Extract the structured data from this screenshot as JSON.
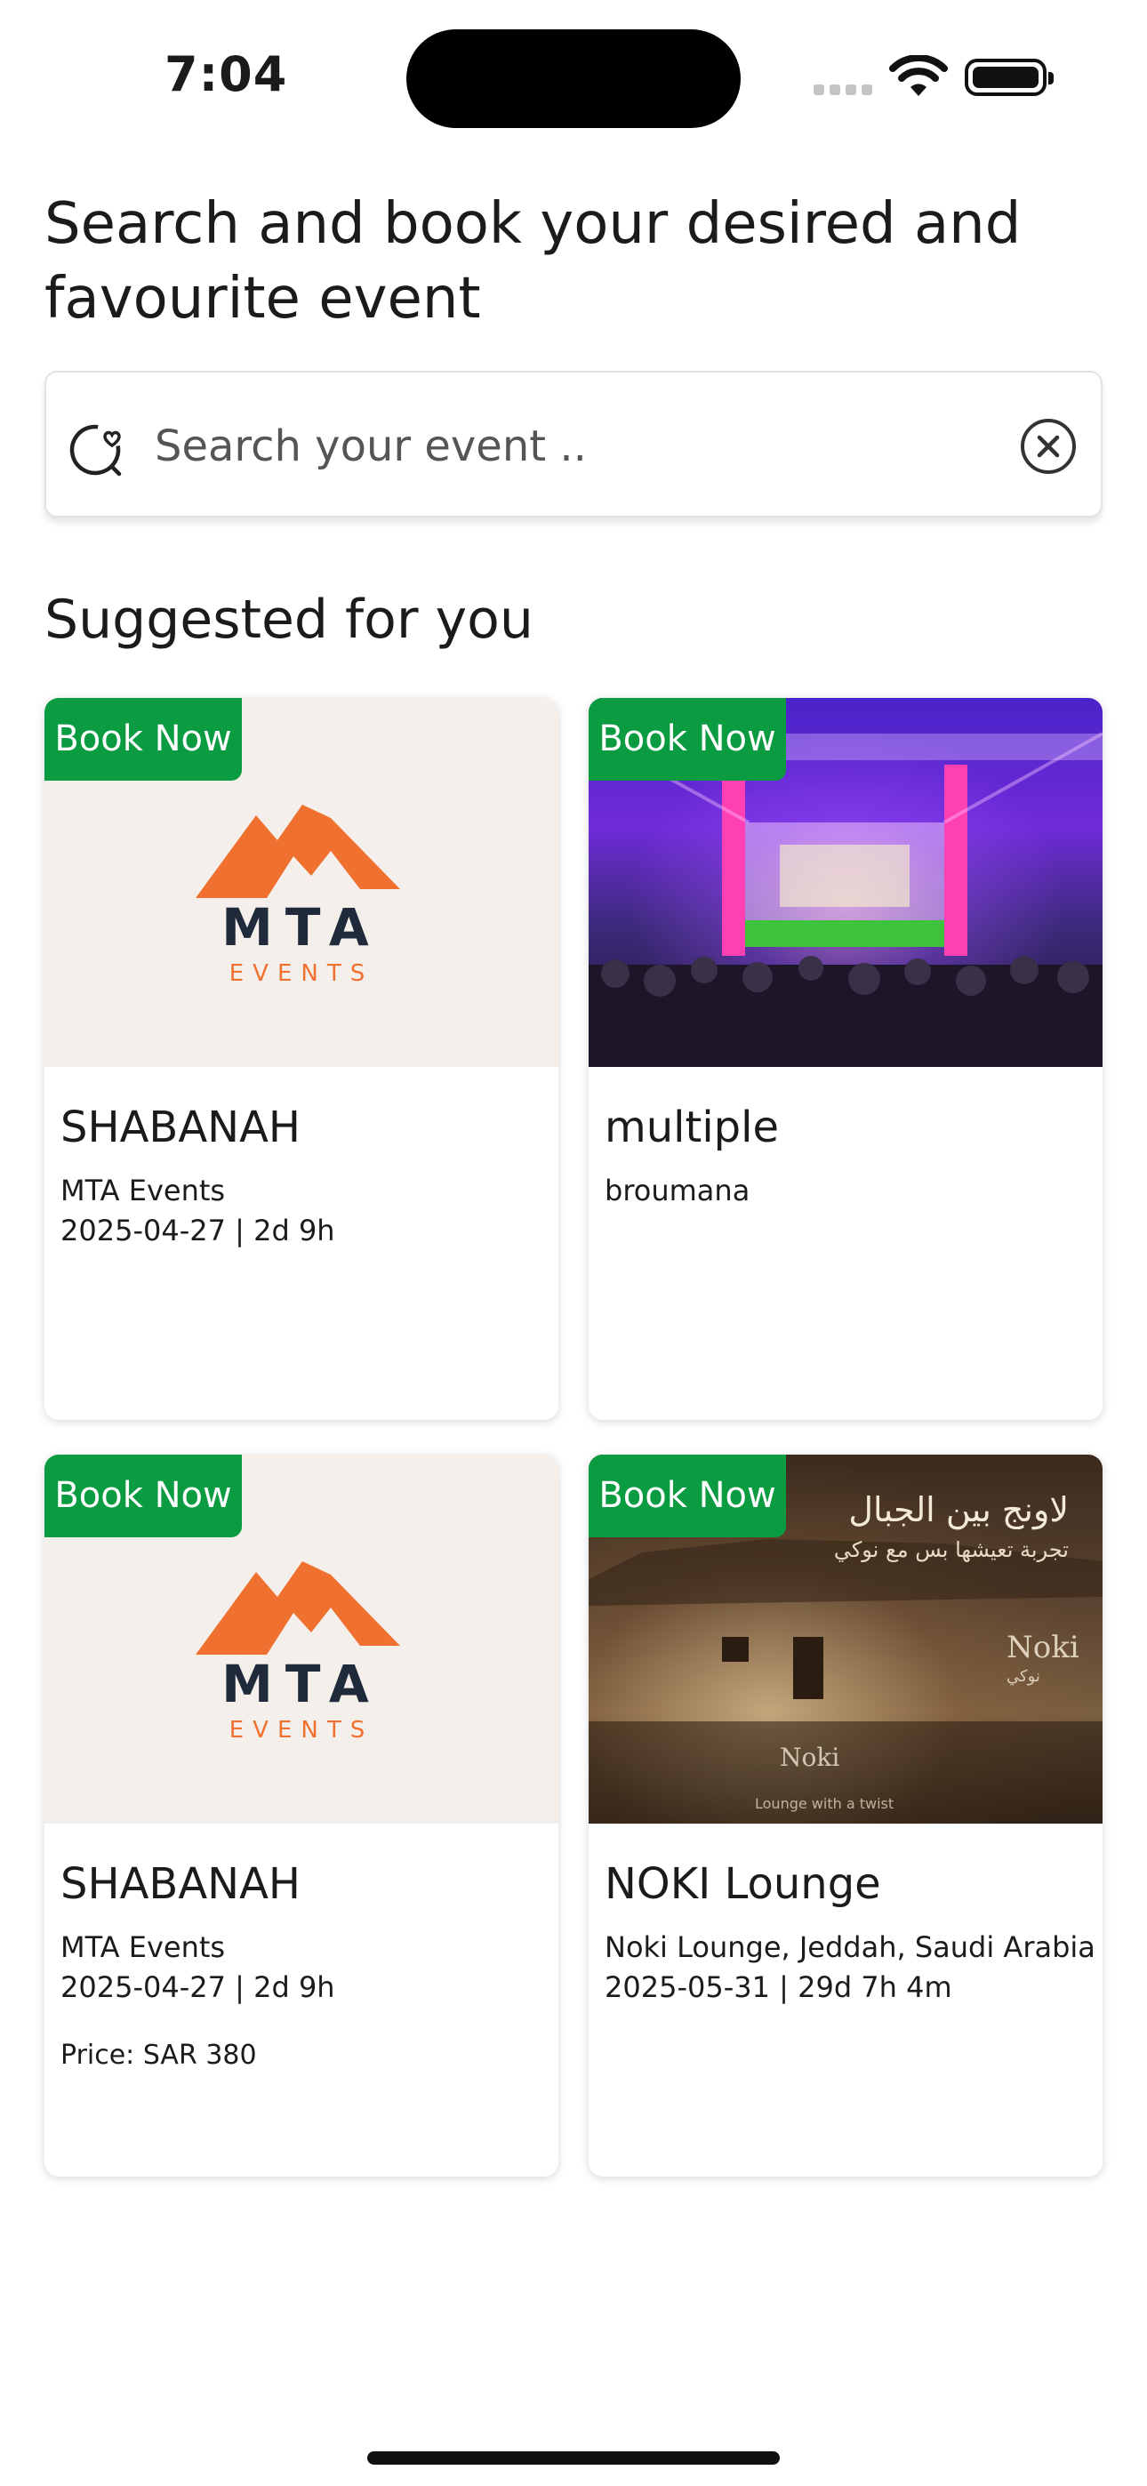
{
  "status_bar": {
    "time": "7:04"
  },
  "header": {
    "title": "Search and book your desired and favourite event"
  },
  "search": {
    "placeholder": "Search your event .."
  },
  "suggested": {
    "title": "Suggested for you",
    "cards": [
      {
        "badge": "Book Now",
        "title": "SHABANAH",
        "lines": [
          "MTA Events",
          "2025-04-27 | 2d 9h"
        ],
        "price": "",
        "image": "mta-events-logo"
      },
      {
        "badge": "Book Now",
        "title": "multiple",
        "lines": [
          "broumana",
          ""
        ],
        "price": "",
        "image": "concert-stage-photo"
      },
      {
        "badge": "Book Now",
        "title": "SHABANAH",
        "lines": [
          "MTA Events",
          "2025-04-27 | 2d 9h"
        ],
        "price": "Price: SAR 380",
        "image": "mta-events-logo"
      },
      {
        "badge": "Book Now",
        "title": "NOKI Lounge",
        "lines": [
          "Noki Lounge, Jeddah, Saudi Arabia",
          "2025-05-31 | 29d 7h 4m"
        ],
        "price": "",
        "image": "noki-lounge-photo"
      }
    ]
  },
  "logos": {
    "mta_letters": "MTA",
    "mta_sub": "EVENTS"
  },
  "noki_image": {
    "headline_ar": "لاونج بين الجبال",
    "sub_ar": "تجربة تعيشها بس مع نوكي",
    "brand": "Noki",
    "brand_ar": "نوكي",
    "tagline": "Lounge with a twist"
  },
  "colors": {
    "accent": "#0b9b41",
    "mta_orange": "#f07030",
    "mta_navy": "#1f2b3a"
  }
}
